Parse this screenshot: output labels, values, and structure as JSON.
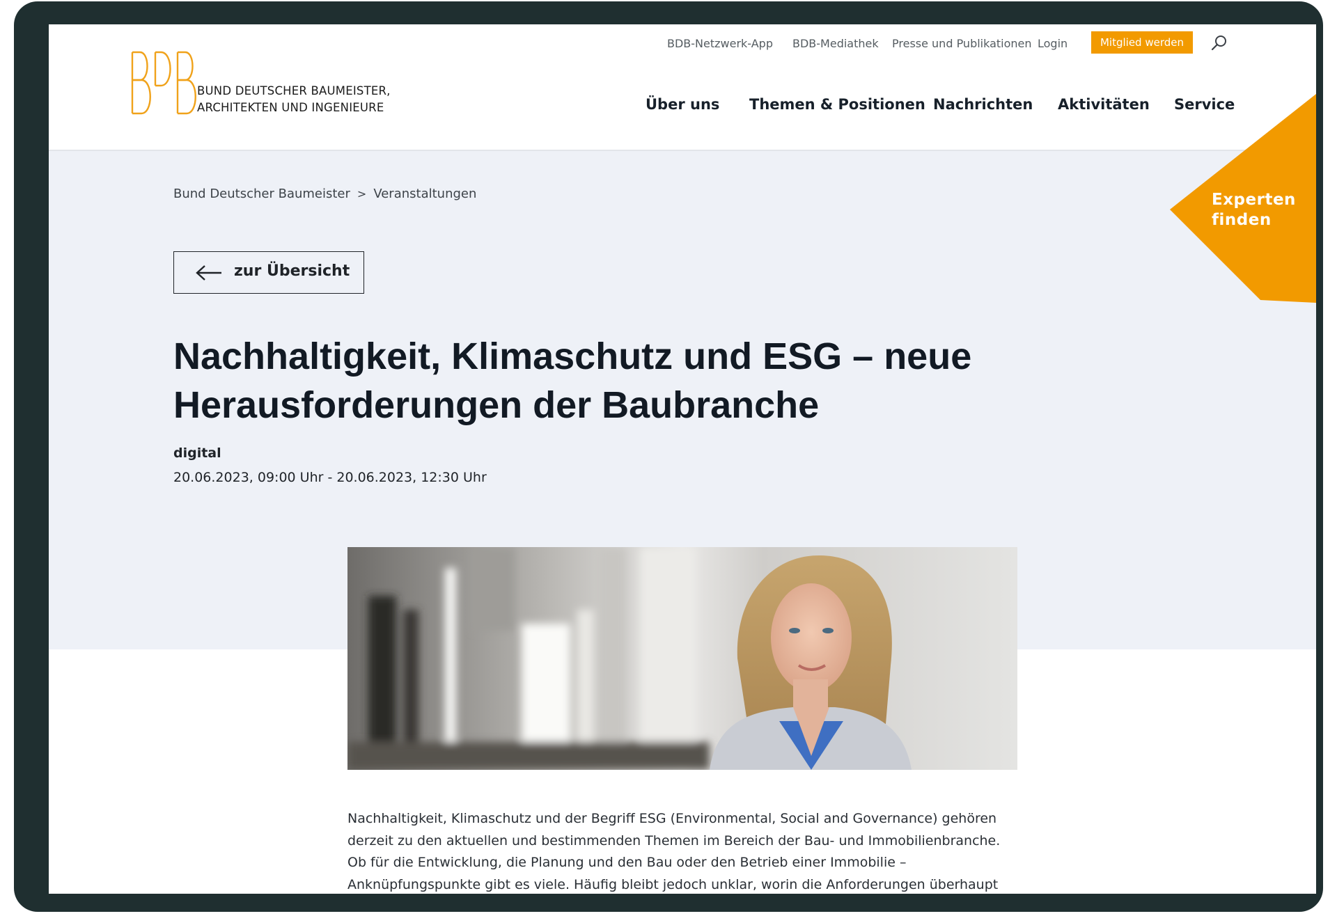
{
  "header": {
    "logo_text_line1": "BUND DEUTSCHER BAUMEISTER,",
    "logo_text_line2": "ARCHITEKTEN UND INGENIEURE",
    "logo_mark": "BDB",
    "utility_nav": [
      "BDB-Netzwerk-App",
      "BDB-Mediathek",
      "Presse und Publikationen",
      "Login"
    ],
    "member_button": "Mitglied werden",
    "search_icon": "search-icon",
    "main_nav": [
      "Über uns",
      "Themen & Positionen",
      "Nachrichten",
      "Aktivitäten",
      "Service"
    ]
  },
  "experts_badge": {
    "line1": "Experten",
    "line2": "finden"
  },
  "breadcrumb": {
    "items": [
      "Bund Deutscher Baumeister",
      "Veranstaltungen"
    ],
    "separator": ">"
  },
  "back_button": {
    "label": "zur Übersicht",
    "icon": "arrow-left-icon"
  },
  "event": {
    "title": "Nachhaltigkeit, Klimaschutz und ESG – neue Herausforderungen der Baubranche",
    "type": "digital",
    "date": "20.06.2023, 09:00 Uhr - 20.06.2023, 12:30 Uhr"
  },
  "article": {
    "body": "Nachhaltigkeit, Klimaschutz und der Begriff ESG (Environmental, Social and Governance) gehören derzeit zu den aktuellen und bestimmenden Themen im Bereich der Bau- und Immobilienbranche. Ob für die Entwicklung, die Planung und den Bau oder den Betrieb einer Immobilie – Anknüpfungspunkte gibt es viele. Häufig bleibt jedoch unklar, worin die Anforderungen überhaupt bestehen und wie sich diese"
  },
  "colors": {
    "accent": "#f29a00",
    "band": "#eef1f7",
    "frame": "#1f2f30",
    "text": "#121a24"
  }
}
